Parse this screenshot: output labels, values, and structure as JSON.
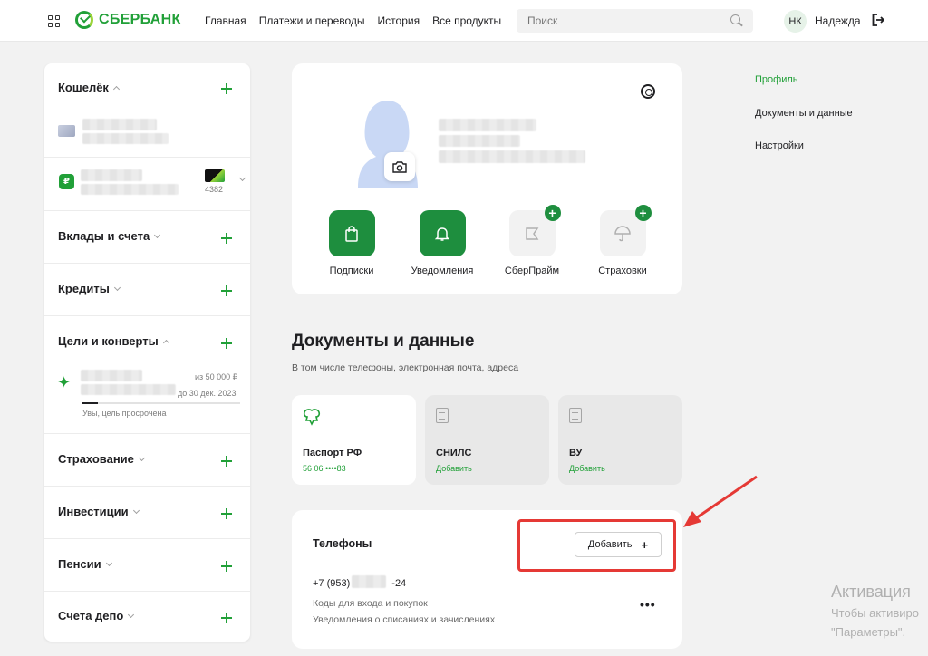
{
  "header": {
    "brand": "СБЕРБАНК",
    "nav": [
      "Главная",
      "Платежи и переводы",
      "История",
      "Все продукты"
    ],
    "search_placeholder": "Поиск",
    "user_initials": "НК",
    "user_name": "Надежда"
  },
  "sidebar": {
    "wallet": {
      "title": "Кошелёк",
      "card_suffix": "4382"
    },
    "deposits": "Вклады и счета",
    "credits": "Кредиты",
    "goals": {
      "title": "Цели и конверты",
      "amount": "из 50 000 ₽",
      "deadline": "до 30 дек. 2023",
      "status": "Увы, цель просрочена",
      "progress": 0.1
    },
    "insurance": "Страхование",
    "investments": "Инвестиции",
    "pensions": "Пенсии",
    "depo": "Счета депо"
  },
  "profile": {
    "services": [
      {
        "label": "Подписки",
        "icon": "bag-icon"
      },
      {
        "label": "Уведомления",
        "icon": "bell-icon"
      },
      {
        "label": "СберПрайм",
        "icon": "prime-icon"
      },
      {
        "label": "Страховки",
        "icon": "umbrella-icon"
      }
    ]
  },
  "documents": {
    "title": "Документы и данные",
    "subtitle": "В том числе телефоны, электронная почта, адреса",
    "items": [
      {
        "name": "Паспорт РФ",
        "value": "56 06 ••••83"
      },
      {
        "name": "СНИЛС",
        "value": "Добавить"
      },
      {
        "name": "ВУ",
        "value": "Добавить"
      }
    ]
  },
  "phones": {
    "title": "Телефоны",
    "add_label": "Добавить",
    "number_prefix": "+7 (953)",
    "number_suffix": "-24",
    "note1": "Коды для входа и покупок",
    "note2": "Уведомления о списаниях и зачислениях"
  },
  "right_nav": [
    "Профиль",
    "Документы и данные",
    "Настройки"
  ],
  "watermark": {
    "line1": "Активация",
    "line2": "Чтобы активиро",
    "line3": "\"Параметры\"."
  },
  "colors": {
    "brand_green": "#21a038",
    "annotation_red": "#e53935"
  }
}
